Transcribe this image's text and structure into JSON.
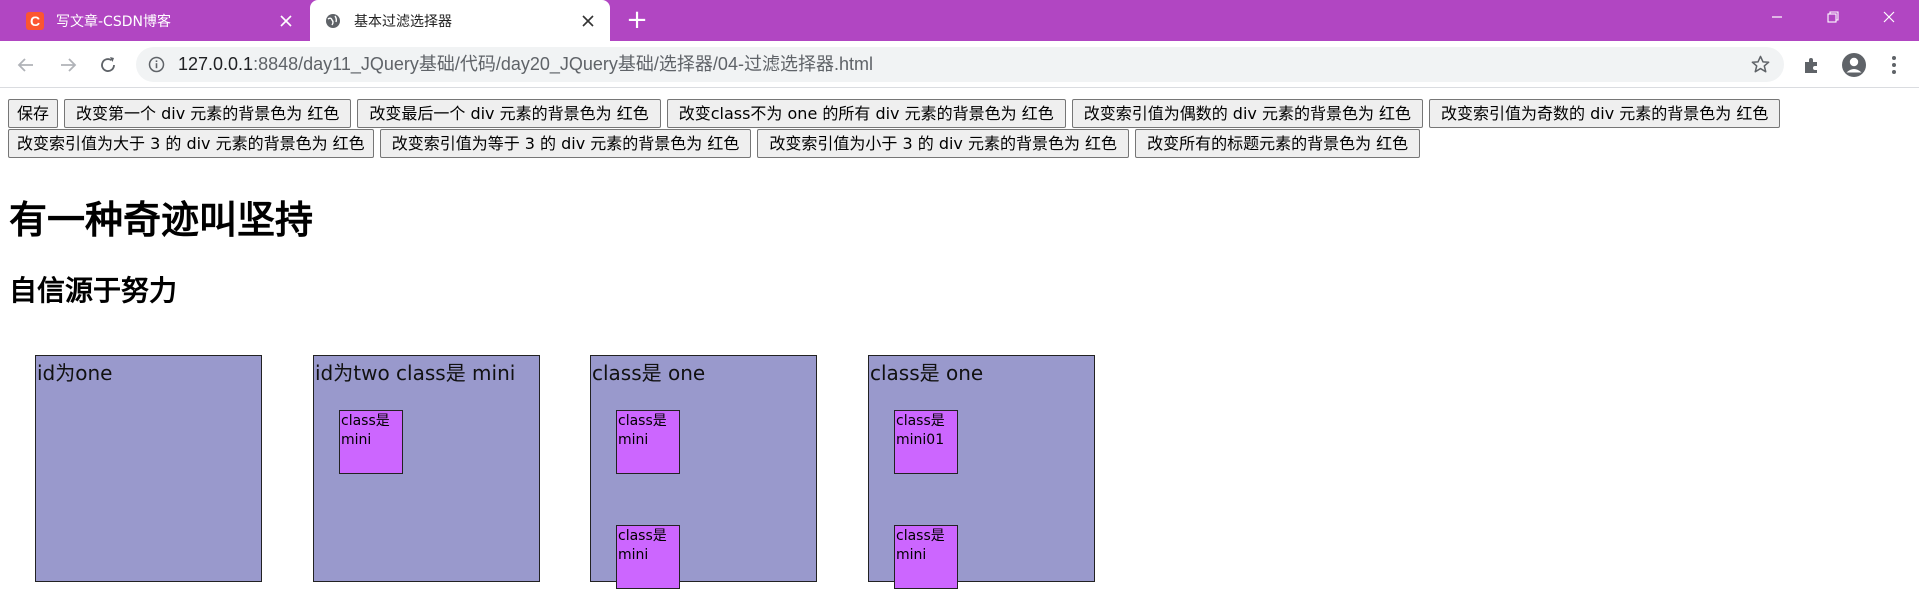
{
  "browser": {
    "tabs": [
      {
        "title": "写文章-CSDN博客",
        "favicon": "C",
        "active": false
      },
      {
        "title": "基本过滤选择器",
        "active": true
      }
    ],
    "new_tab_label": "+",
    "url_host": "127.0.0.1",
    "url_rest": ":8848/day11_JQuery基础/代码/day20_JQuery基础/选择器/04-过滤选择器.html",
    "colors": {
      "tab_strip": "#b146c2",
      "omnibox": "#f1f3f4"
    }
  },
  "buttons": {
    "row1": [
      "保存",
      "改变第一个 div 元素的背景色为 红色",
      "改变最后一个 div 元素的背景色为 红色",
      "改变class不为 one 的所有 div 元素的背景色为 红色",
      "改变索引值为偶数的 div 元素的背景色为 红色",
      "改变索引值为奇数的 div 元素的背景色为 红色"
    ],
    "row2": [
      "改变索引值为大于 3 的 div 元素的背景色为 红色",
      "改变索引值为等于 3 的 div 元素的背景色为 红色",
      "改变索引值为小于 3 的 div 元素的背景色为 红色",
      "改变所有的标题元素的背景色为 红色"
    ]
  },
  "headings": {
    "h1": "有一种奇迹叫坚持",
    "h2": "自信源于努力"
  },
  "boxes": [
    {
      "label": "id为one",
      "minis": []
    },
    {
      "label": "id为two class是 mini",
      "minis": [
        "class是mini"
      ]
    },
    {
      "label": "class是 one",
      "minis": [
        "class是mini",
        "class是mini"
      ]
    },
    {
      "label": "class是 one",
      "minis": [
        "class是mini01",
        "class是mini"
      ]
    }
  ],
  "colors": {
    "box_bg": "#9999cc",
    "mini_bg": "#cc66ff"
  }
}
